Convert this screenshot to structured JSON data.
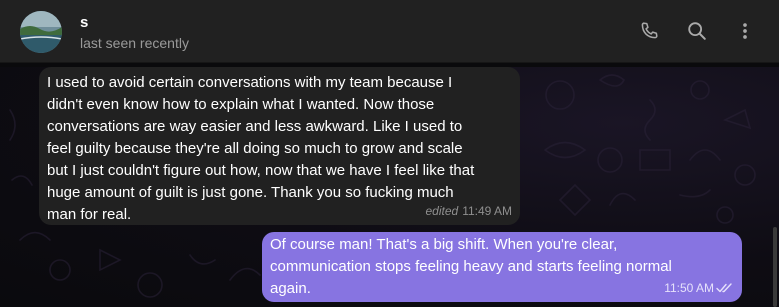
{
  "header": {
    "name": "s",
    "status": "last seen recently",
    "icons": [
      "phone-icon",
      "search-icon",
      "more-vertical-icon"
    ]
  },
  "messages": [
    {
      "direction": "incoming",
      "lines": [
        "I used to avoid certain conversations with my team because I",
        "didn't even know how to explain what I wanted. Now those",
        "conversations are way easier and less awkward. Like I used to",
        "feel guilty because they're all doing so much to grow and scale",
        "but I just couldn't figure out how, now that we have I feel like that",
        "huge amount of guilt is just gone. Thank you so fucking much",
        "man for real."
      ],
      "edited": "edited",
      "time": "11:49 AM"
    },
    {
      "direction": "outgoing",
      "lines": [
        "Of course man! That's a big shift. When you're clear,",
        "communication stops feeling heavy and starts feeling normal",
        "again."
      ],
      "time": "11:50 AM",
      "status_icon": "double-check-icon"
    }
  ],
  "colors": {
    "header_bg": "#212121",
    "incoming_bubble": "#212121",
    "outgoing_bubble": "#8774e1",
    "chat_bg": "#0c0b10"
  }
}
